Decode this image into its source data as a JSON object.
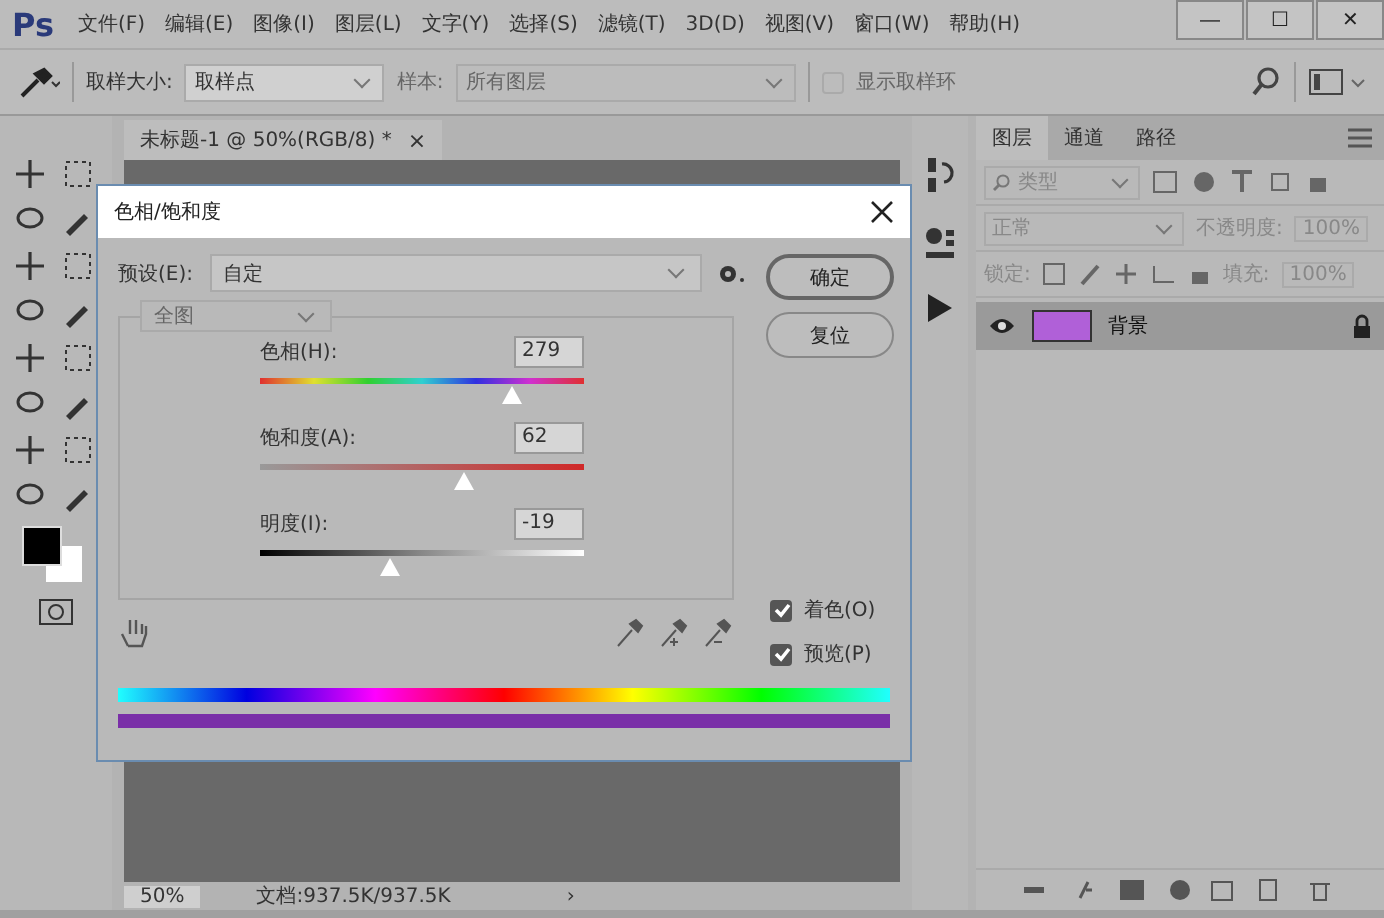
{
  "app": {
    "logo": "Ps"
  },
  "menu": [
    "文件(F)",
    "编辑(E)",
    "图像(I)",
    "图层(L)",
    "文字(Y)",
    "选择(S)",
    "滤镜(T)",
    "3D(D)",
    "视图(V)",
    "窗口(W)",
    "帮助(H)"
  ],
  "window_controls": [
    "—",
    "☐",
    "✕"
  ],
  "options_bar": {
    "size_label": "取样大小:",
    "size_value": "取样点",
    "sample_label": "样本:",
    "sample_value": "所有图层",
    "sample_disabled": true,
    "ring": {
      "label": "显示取样环",
      "checked": false,
      "disabled": true
    }
  },
  "document": {
    "tab": "未标题-1 @ 50%(RGB/8) *",
    "close": "×",
    "zoom": "50%",
    "doc_info": "文档:937.5K/937.5K",
    "arrow": "›"
  },
  "layers_panel": {
    "tabs": [
      {
        "label": "图层",
        "selected": true
      },
      {
        "label": "通道",
        "selected": false
      },
      {
        "label": "路径",
        "selected": false
      }
    ],
    "filter": "类型",
    "blend_mode": "正常",
    "opacity_label": "不透明度:",
    "opacity": "100%",
    "lock_label": "锁定:",
    "fill_label": "填充:",
    "fill": "100%",
    "layers": [
      {
        "name": "背景",
        "color": "#b060d8",
        "visible": true,
        "locked": true
      }
    ]
  },
  "dialog": {
    "title": "色相/饱和度",
    "preset_label": "预设(E):",
    "preset": "自定",
    "buttons": [
      {
        "label": "确定",
        "default": true
      },
      {
        "label": "复位",
        "default": false
      }
    ],
    "range": {
      "value": "全图",
      "disabled": true
    },
    "sliders": [
      {
        "kind": "hue",
        "label": "色相(H):",
        "value": "279",
        "level": 0.78
      },
      {
        "kind": "saturation",
        "label": "饱和度(A):",
        "value": "62",
        "level": 0.63
      },
      {
        "kind": "lightness",
        "label": "明度(I):",
        "value": "-19",
        "level": 0.4
      }
    ],
    "checkboxes": [
      {
        "label": "着色(O)",
        "checked": true
      },
      {
        "label": "预览(P)",
        "checked": true
      }
    ]
  }
}
